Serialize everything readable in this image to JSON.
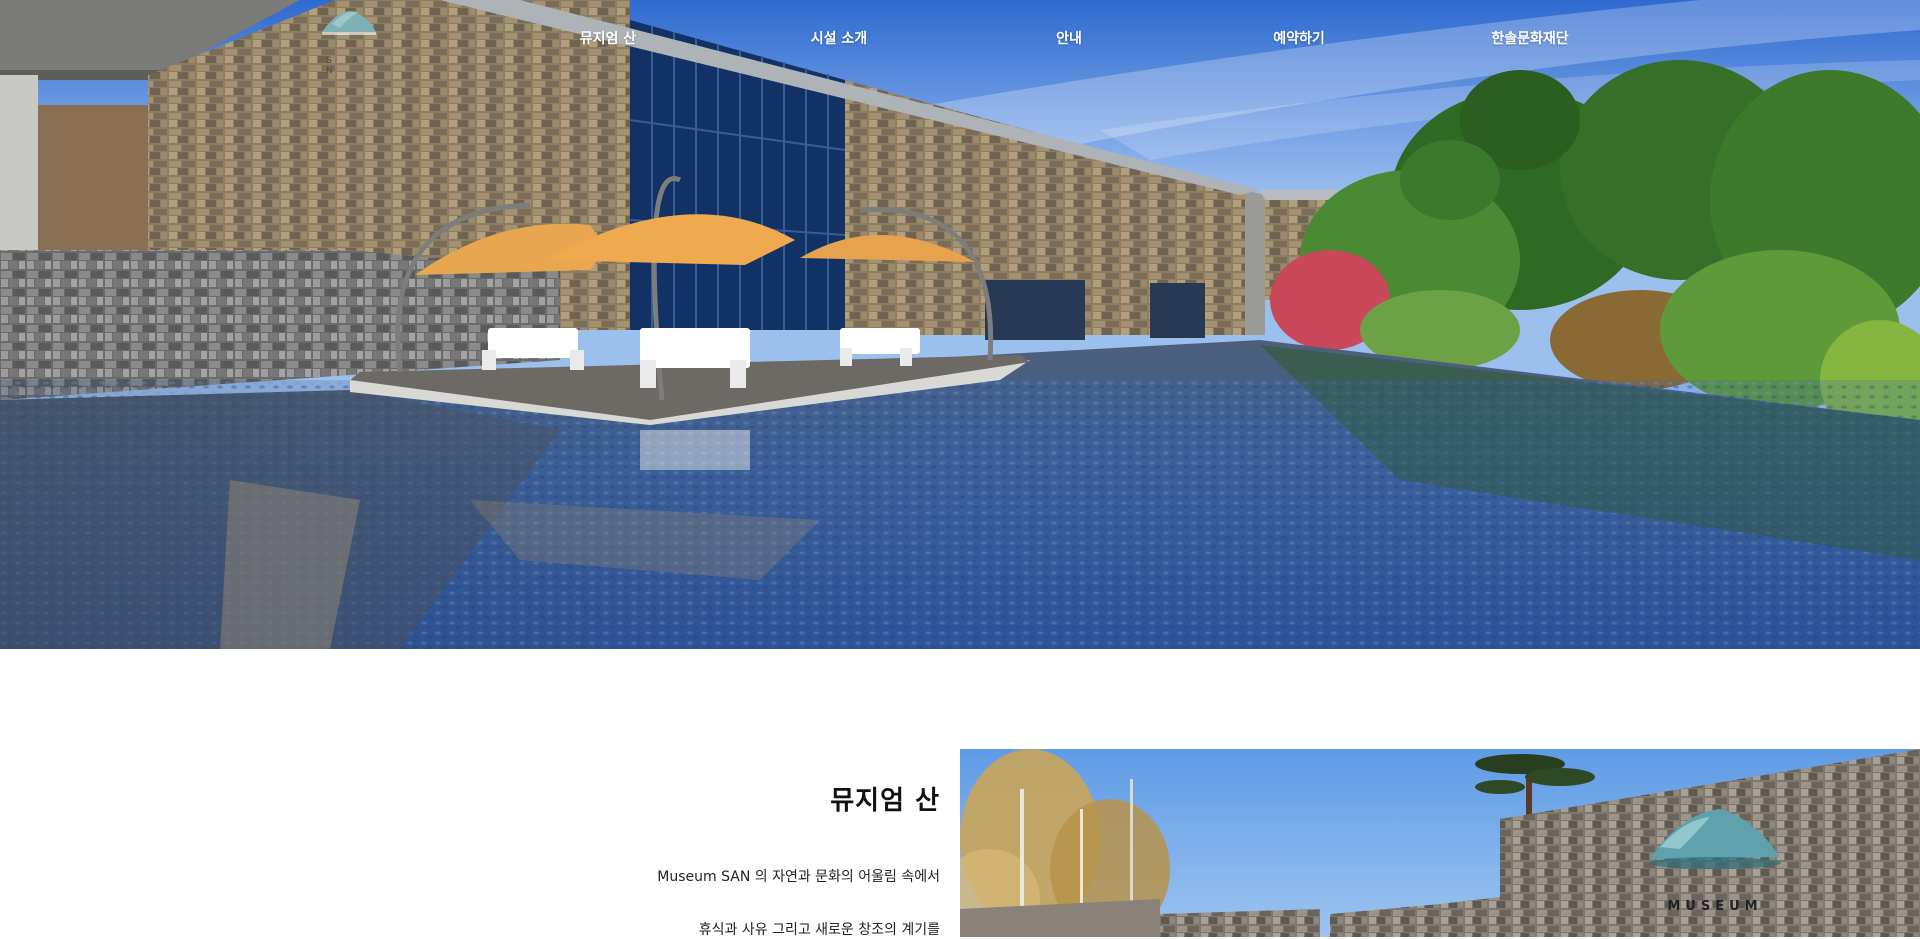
{
  "logo": {
    "icon": "museum-san-mountain-logo",
    "text": "S A N"
  },
  "nav": {
    "items": [
      {
        "label": "뮤지엄 산"
      },
      {
        "label": "시설 소개"
      },
      {
        "label": "안내"
      },
      {
        "label": "예약하기"
      },
      {
        "label": "한솔문화재단"
      }
    ]
  },
  "hero": {
    "image": "museum-building-water-garden-photo"
  },
  "intro": {
    "title": "뮤지엄 산",
    "line1": "Museum SAN 의 자연과 문화의 어울림 속에서",
    "line2": "휴식과 사유 그리고 새로운 창조의 계기를",
    "image": "museum-entrance-stone-wall-photo",
    "sign_word": "MUSEUM"
  },
  "colors": {
    "nav_text": "#ffffff",
    "logo_teal": "#6fa9ad",
    "background": "#ffffff"
  }
}
